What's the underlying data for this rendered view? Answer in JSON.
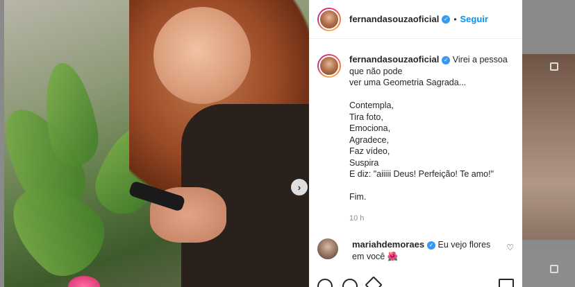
{
  "header": {
    "username": "fernandasouzaoficial",
    "separator": "•",
    "follow_label": "Seguir"
  },
  "caption": {
    "username": "fernandasouzaoficial",
    "lines": [
      "Virei a pessoa",
      "que não pode",
      "ver uma Geometria Sagrada...",
      "",
      "Contempla,",
      "Tira foto,",
      "Emociona,",
      "Agradece,",
      "Faz vídeo,",
      "Suspira",
      "E diz: \"aiiiii Deus! Perfeição! Te amo!\"",
      "",
      "Fim."
    ],
    "timestamp": "10 h"
  },
  "comment": {
    "username": "mariahdemoraes",
    "text": "Eu vejo flores em você",
    "emoji": "🌺"
  },
  "icons": {
    "verified": "verified-badge-icon",
    "next": "chevron-right-icon",
    "like": "heart-icon",
    "comment": "comment-icon",
    "share": "paper-plane-icon",
    "save": "bookmark-icon"
  },
  "colors": {
    "accent": "#0095f6",
    "verified": "#3897f0",
    "text": "#262626",
    "muted": "#8e8e8e"
  }
}
